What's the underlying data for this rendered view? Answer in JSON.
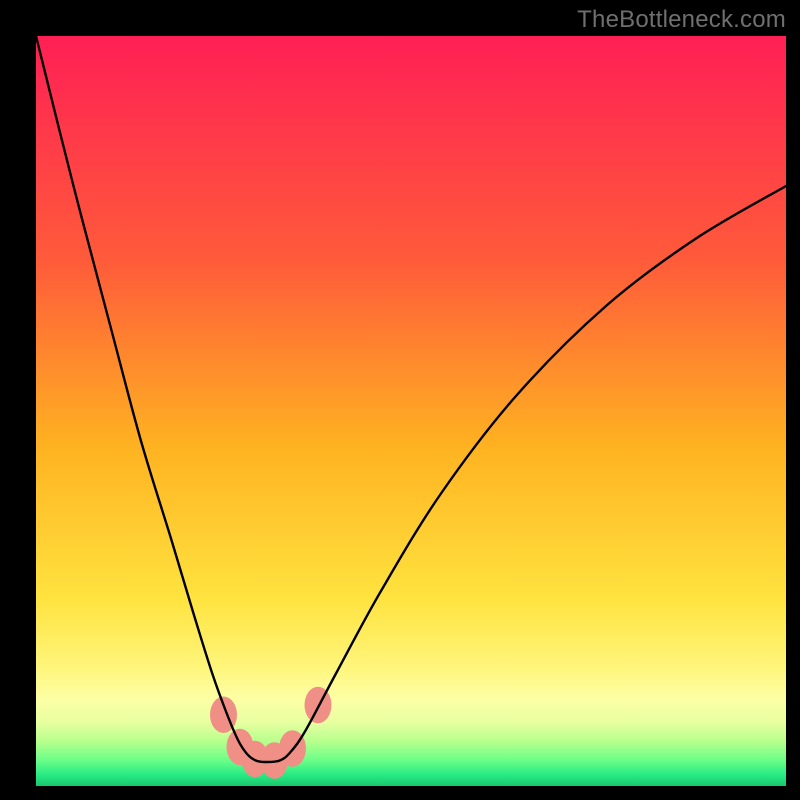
{
  "watermark": "TheBottleneck.com",
  "chart_data": {
    "type": "line",
    "title": "",
    "xlabel": "",
    "ylabel": "",
    "xlim": [
      0,
      100
    ],
    "ylim": [
      0,
      100
    ],
    "axes_visible": false,
    "background_gradient": {
      "stops": [
        {
          "offset": 0.0,
          "color": "#ff1f55"
        },
        {
          "offset": 0.3,
          "color": "#ff5b3a"
        },
        {
          "offset": 0.55,
          "color": "#ffb321"
        },
        {
          "offset": 0.75,
          "color": "#ffe33f"
        },
        {
          "offset": 0.84,
          "color": "#fff57a"
        },
        {
          "offset": 0.885,
          "color": "#fdffa6"
        },
        {
          "offset": 0.915,
          "color": "#e7ffa0"
        },
        {
          "offset": 0.94,
          "color": "#b8ff8e"
        },
        {
          "offset": 0.965,
          "color": "#6dff88"
        },
        {
          "offset": 0.985,
          "color": "#28eb84"
        },
        {
          "offset": 1.0,
          "color": "#18c76e"
        }
      ]
    },
    "series": [
      {
        "name": "bottleneck-curve",
        "color": "#000000",
        "width": 2.2,
        "x": [
          0,
          5,
          10,
          14,
          18,
          21,
          23.5,
          25.5,
          27,
          28.2,
          29.3,
          30.5,
          32.5,
          34,
          36,
          40,
          46,
          54,
          64,
          76,
          88,
          100
        ],
        "y": [
          100,
          80,
          61,
          46,
          33,
          23,
          15,
          9.5,
          6,
          4.2,
          3.4,
          3.2,
          3.4,
          4.6,
          7.5,
          15,
          26,
          39,
          52,
          64,
          73,
          80
        ]
      }
    ],
    "markers": [
      {
        "name": "marker-1",
        "x": 25.0,
        "y": 9.5,
        "r": 1.8,
        "color": "#f08f86"
      },
      {
        "name": "marker-2",
        "x": 27.2,
        "y": 5.2,
        "r": 1.8,
        "color": "#f08f86"
      },
      {
        "name": "marker-3",
        "x": 29.2,
        "y": 3.6,
        "r": 1.8,
        "color": "#f08f86"
      },
      {
        "name": "marker-4",
        "x": 31.8,
        "y": 3.4,
        "r": 1.8,
        "color": "#f08f86"
      },
      {
        "name": "marker-5",
        "x": 34.2,
        "y": 5.0,
        "r": 1.8,
        "color": "#f08f86"
      },
      {
        "name": "marker-6",
        "x": 37.6,
        "y": 10.8,
        "r": 1.8,
        "color": "#f08f86"
      }
    ]
  }
}
